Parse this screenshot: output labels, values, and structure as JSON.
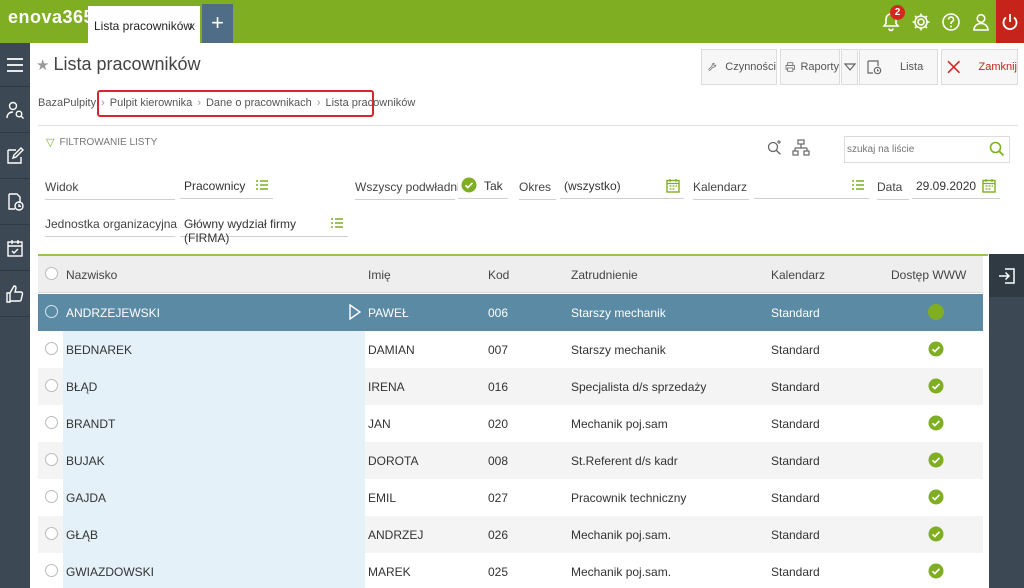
{
  "app": {
    "logo": "enova365",
    "logo_sub": ""
  },
  "tabs": [
    {
      "label": "Lista pracowników",
      "close": "x"
    }
  ],
  "topbar": {
    "notifications_count": "2"
  },
  "page": {
    "title": "Lista pracowników"
  },
  "toolbar": {
    "czynnosci": "Czynności",
    "raporty": "Raporty",
    "lista": "Lista",
    "zamknij": "Zamknij"
  },
  "breadcrumb": [
    "BazaPulpity",
    "Pulpit kierownika",
    "Dane o pracownikach",
    "Lista pracowników"
  ],
  "filter": {
    "header": "FILTROWANIE LISTY",
    "search_placeholder": "szukaj na liście",
    "widok_label": "Widok",
    "widok_value": "Pracownicy",
    "podwladni_label": "Wszyscy podwładni",
    "podwladni_value": "Tak",
    "okres_label": "Okres",
    "okres_value": "(wszystko)",
    "kalendarz_label": "Kalendarz",
    "kalendarz_value": "",
    "data_label": "Data",
    "data_value": "29.09.2020",
    "jednostka_label": "Jednostka organizacyjna",
    "jednostka_value": "Główny wydział firmy (FIRMA)"
  },
  "table": {
    "columns": [
      "Nazwisko",
      "Imię",
      "Kod",
      "Zatrudnienie",
      "Kalendarz",
      "Dostęp WWW"
    ],
    "rows": [
      {
        "nazwisko": "ANDRZEJEWSKI",
        "imie": "PAWEŁ",
        "kod": "006",
        "zatrudnienie": "Starszy mechanik",
        "kalendarz": "Standard",
        "www": true,
        "selected": true
      },
      {
        "nazwisko": "BEDNAREK",
        "imie": "DAMIAN",
        "kod": "007",
        "zatrudnienie": "Starszy mechanik",
        "kalendarz": "Standard",
        "www": true
      },
      {
        "nazwisko": "BŁĄD",
        "imie": "IRENA",
        "kod": "016",
        "zatrudnienie": "Specjalista d/s sprzedaży",
        "kalendarz": "Standard",
        "www": true
      },
      {
        "nazwisko": "BRANDT",
        "imie": "JAN",
        "kod": "020",
        "zatrudnienie": "Mechanik poj.sam",
        "kalendarz": "Standard",
        "www": true
      },
      {
        "nazwisko": "BUJAK",
        "imie": "DOROTA",
        "kod": "008",
        "zatrudnienie": "St.Referent d/s kadr",
        "kalendarz": "Standard",
        "www": true
      },
      {
        "nazwisko": "GAJDA",
        "imie": "EMIL",
        "kod": "027",
        "zatrudnienie": "Pracownik techniczny",
        "kalendarz": "Standard",
        "www": true
      },
      {
        "nazwisko": "GŁĄB",
        "imie": "ANDRZEJ",
        "kod": "026",
        "zatrudnienie": "Mechanik poj.sam.",
        "kalendarz": "Standard",
        "www": true
      },
      {
        "nazwisko": "GWIAZDOWSKI",
        "imie": "MAREK",
        "kod": "025",
        "zatrudnienie": "Mechanik poj.sam.",
        "kalendarz": "Standard",
        "www": true
      }
    ]
  },
  "colors": {
    "brand": "#7fae23",
    "rail": "#3c4954",
    "selected_row": "#5b8aa5",
    "danger": "#c6231b"
  }
}
